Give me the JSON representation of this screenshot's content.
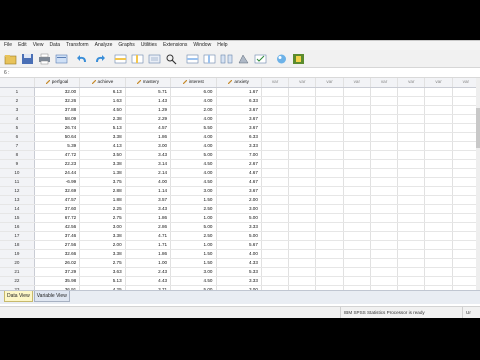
{
  "menu": [
    "File",
    "Edit",
    "View",
    "Data",
    "Transform",
    "Analyze",
    "Graphs",
    "Utilities",
    "Extensions",
    "Window",
    "Help"
  ],
  "toolbar": {
    "icons": [
      "open-icon",
      "save-icon",
      "print-icon",
      "dialog-recall-icon",
      "undo-icon",
      "redo-icon",
      "goto-case-icon",
      "goto-variable-icon",
      "variables-icon",
      "find-icon",
      "insert-cases-icon",
      "insert-variable-icon",
      "split-file-icon",
      "weight-cases-icon",
      "select-cases-icon",
      "value-labels-icon",
      "use-sets-icon"
    ]
  },
  "cell_ref": "6 :",
  "columns": [
    "perfgoal",
    "achieve",
    "mastery",
    "interest",
    "anxiety"
  ],
  "empty_col_label": "var",
  "rows": [
    [
      "32.00",
      "6.13",
      "5.71",
      "6.00",
      "1.67"
    ],
    [
      "32.26",
      "1.63",
      "1.43",
      "4.00",
      "6.33"
    ],
    [
      "37.88",
      "4.50",
      "1.29",
      "2.00",
      "3.67"
    ],
    [
      "58.09",
      "2.38",
      "2.29",
      "4.00",
      "3.67"
    ],
    [
      "26.74",
      "5.13",
      "4.57",
      "5.50",
      "3.67"
    ],
    [
      "50.64",
      "3.38",
      "1.86",
      "4.00",
      "6.33"
    ],
    [
      "5.39",
      "4.13",
      "3.00",
      "4.00",
      "3.33"
    ],
    [
      "47.72",
      "3.50",
      "3.43",
      "5.00",
      "7.00"
    ],
    [
      "22.23",
      "3.38",
      "3.14",
      "4.50",
      "2.67"
    ],
    [
      "24.44",
      "1.38",
      "2.14",
      "4.00",
      "4.67"
    ],
    [
      "-6.99",
      "3.75",
      "4.00",
      "4.50",
      "4.67"
    ],
    [
      "32.69",
      "2.88",
      "1.14",
      "3.00",
      "3.67"
    ],
    [
      "47.57",
      "1.88",
      "3.57",
      "1.50",
      "2.00"
    ],
    [
      "37.60",
      "2.25",
      "3.43",
      "2.50",
      "3.00"
    ],
    [
      "67.72",
      "2.75",
      "1.86",
      "1.00",
      "5.00"
    ],
    [
      "42.56",
      "3.00",
      "2.86",
      "5.00",
      "3.33"
    ],
    [
      "37.46",
      "3.38",
      "4.71",
      "2.50",
      "5.00"
    ],
    [
      "27.56",
      "2.00",
      "1.71",
      "1.00",
      "5.67"
    ],
    [
      "32.66",
      "3.38",
      "1.86",
      "1.50",
      "4.00"
    ],
    [
      "26.02",
      "2.75",
      "1.00",
      "1.50",
      "4.33"
    ],
    [
      "37.29",
      "3.63",
      "2.43",
      "3.00",
      "5.33"
    ],
    [
      "35.98",
      "5.13",
      "4.43",
      "4.50",
      "3.33"
    ],
    [
      "36.91",
      "4.25",
      "3.71",
      "5.00",
      "3.00"
    ]
  ],
  "tabs": [
    "Data View",
    "Variable View"
  ],
  "status": "IBM SPSS Statistics Processor is ready",
  "status_extra": "Ur"
}
